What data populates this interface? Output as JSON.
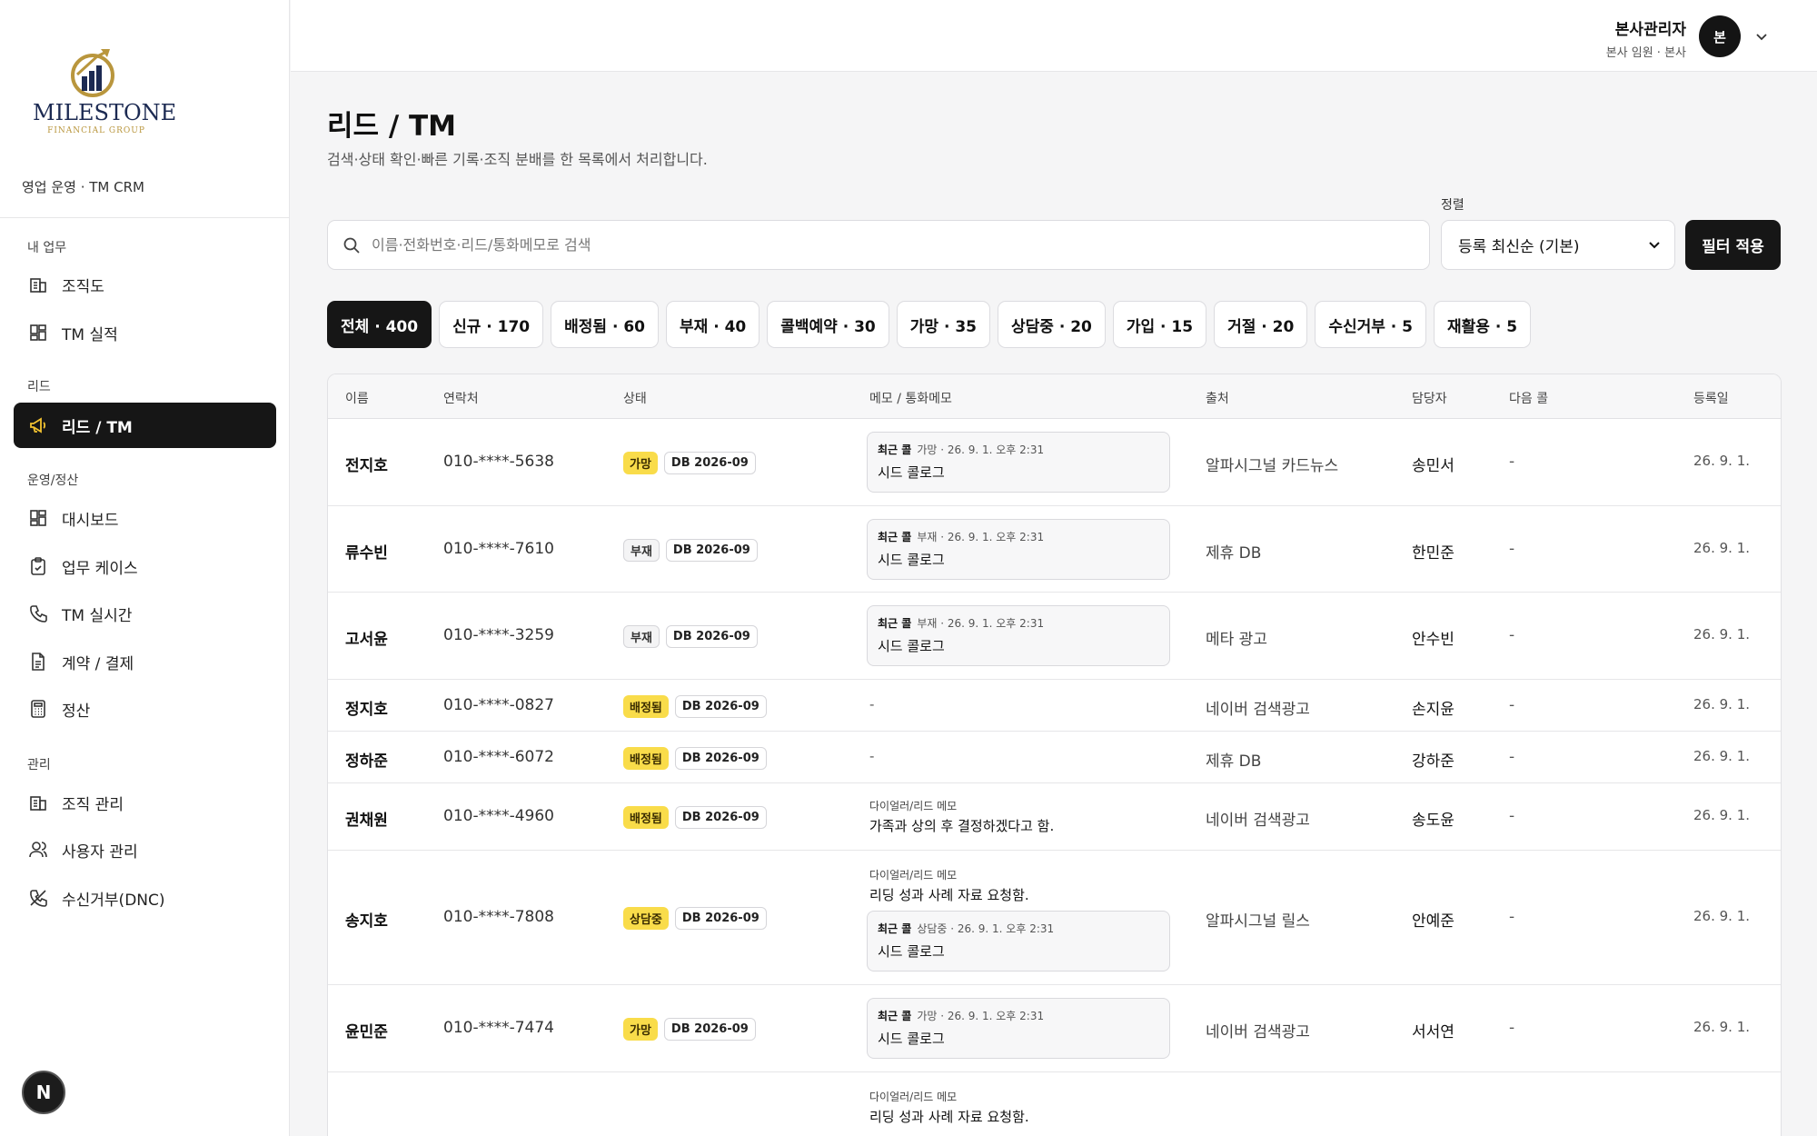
{
  "brand": {
    "name": "MILESTONE",
    "sub": "FINANCIAL GROUP",
    "org": "영업 운영 · TM CRM"
  },
  "sidebar": {
    "groups": [
      {
        "label": "내 업무",
        "items": [
          {
            "label": "조직도",
            "icon": "building-icon"
          },
          {
            "label": "TM 실적",
            "icon": "grid-icon"
          }
        ]
      },
      {
        "label": "리드",
        "items": [
          {
            "label": "리드 / TM",
            "icon": "megaphone-icon",
            "active": true
          }
        ]
      },
      {
        "label": "운영/정산",
        "items": [
          {
            "label": "대시보드",
            "icon": "grid-icon"
          },
          {
            "label": "업무 케이스",
            "icon": "clipboard-icon"
          },
          {
            "label": "TM 실시간",
            "icon": "phone-icon"
          },
          {
            "label": "계약 / 결제",
            "icon": "document-icon"
          },
          {
            "label": "정산",
            "icon": "calculator-icon"
          }
        ]
      },
      {
        "label": "관리",
        "items": [
          {
            "label": "조직 관리",
            "icon": "building-icon"
          },
          {
            "label": "사용자 관리",
            "icon": "users-icon"
          },
          {
            "label": "수신거부(DNC)",
            "icon": "phone-off-icon"
          }
        ]
      }
    ],
    "bottom_badge": "N"
  },
  "header": {
    "user_name": "본사관리자",
    "user_role": "본사 임원 · 본사",
    "avatar": "본"
  },
  "main": {
    "title": "리드 / TM",
    "subtitle": "검색·상태 확인·빠른 기록·조직 분배를 한 목록에서 처리합니다.",
    "search_placeholder": "이름·전화번호·리드/통화메모로 검색",
    "sort_label": "정렬",
    "sort_value": "등록 최신순 (기본)",
    "apply_label": "필터 적용",
    "tabs": [
      {
        "label": "전체 · 400",
        "active": true
      },
      {
        "label": "신규 · 170"
      },
      {
        "label": "배정됨 · 60"
      },
      {
        "label": "부재 · 40"
      },
      {
        "label": "콜백예약 · 30"
      },
      {
        "label": "가망 · 35"
      },
      {
        "label": "상담중 · 20"
      },
      {
        "label": "가입 · 15"
      },
      {
        "label": "거절 · 20"
      },
      {
        "label": "수신거부 · 5"
      },
      {
        "label": "재활용 · 5"
      }
    ]
  },
  "table": {
    "columns": [
      "이름",
      "연락처",
      "상태",
      "메모 / 통화메모",
      "출처",
      "담당자",
      "다음 콜",
      "등록일"
    ],
    "rows": [
      {
        "name": "전지호",
        "phone": "010-****-5638",
        "status": "가망",
        "status_style": "yellow",
        "db": "DB 2026-09",
        "memo_call": {
          "h": "최근 콜",
          "meta": "가망 · 26. 9. 1. 오후 2:31",
          "body": "시드 콜로그"
        },
        "source": "알파시그널 카드뉴스",
        "agent": "송민서",
        "next": "-",
        "date": "26. 9. 1."
      },
      {
        "name": "류수빈",
        "phone": "010-****-7610",
        "status": "부재",
        "status_style": "gray",
        "db": "DB 2026-09",
        "memo_call": {
          "h": "최근 콜",
          "meta": "부재 · 26. 9. 1. 오후 2:31",
          "body": "시드 콜로그"
        },
        "source": "제휴 DB",
        "agent": "한민준",
        "next": "-",
        "date": "26. 9. 1."
      },
      {
        "name": "고서윤",
        "phone": "010-****-3259",
        "status": "부재",
        "status_style": "gray",
        "db": "DB 2026-09",
        "memo_call": {
          "h": "최근 콜",
          "meta": "부재 · 26. 9. 1. 오후 2:31",
          "body": "시드 콜로그"
        },
        "source": "메타 광고",
        "agent": "안수빈",
        "next": "-",
        "date": "26. 9. 1."
      },
      {
        "name": "정지호",
        "phone": "010-****-0827",
        "status": "배정됨",
        "status_style": "yellow",
        "db": "DB 2026-09",
        "memo_dash": "-",
        "source": "네이버 검색광고",
        "agent": "손지윤",
        "next": "-",
        "date": "26. 9. 1."
      },
      {
        "name": "정하준",
        "phone": "010-****-6072",
        "status": "배정됨",
        "status_style": "yellow",
        "db": "DB 2026-09",
        "memo_dash": "-",
        "source": "제휴 DB",
        "agent": "강하준",
        "next": "-",
        "date": "26. 9. 1."
      },
      {
        "name": "권채원",
        "phone": "010-****-4960",
        "status": "배정됨",
        "status_style": "yellow",
        "db": "DB 2026-09",
        "memo_note": {
          "h": "다이얼러/리드 메모",
          "body": "가족과 상의 후 결정하겠다고 함."
        },
        "source": "네이버 검색광고",
        "agent": "송도윤",
        "next": "-",
        "date": "26. 9. 1."
      },
      {
        "name": "송지호",
        "phone": "010-****-7808",
        "status": "상담중",
        "status_style": "yellow",
        "db": "DB 2026-09",
        "memo_note": {
          "h": "다이얼러/리드 메모",
          "body": "리딩 성과 사례 자료 요청함."
        },
        "memo_call": {
          "h": "최근 콜",
          "meta": "상담중 · 26. 9. 1. 오후 2:31",
          "body": "시드 콜로그"
        },
        "source": "알파시그널 릴스",
        "agent": "안예준",
        "next": "-",
        "date": "26. 9. 1."
      },
      {
        "name": "윤민준",
        "phone": "010-****-7474",
        "status": "가망",
        "status_style": "yellow",
        "db": "DB 2026-09",
        "memo_call": {
          "h": "최근 콜",
          "meta": "가망 · 26. 9. 1. 오후 2:31",
          "body": "시드 콜로그"
        },
        "source": "네이버 검색광고",
        "agent": "서서연",
        "next": "-",
        "date": "26. 9. 1."
      },
      {
        "memo_note": {
          "h": "다이얼러/리드 메모",
          "body": "리딩 성과 사례 자료 요청함."
        }
      }
    ]
  }
}
